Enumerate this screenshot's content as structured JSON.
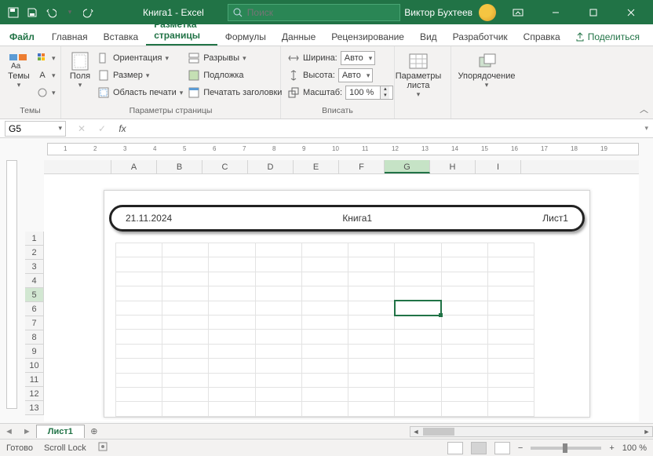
{
  "titlebar": {
    "title": "Книга1  -  Excel",
    "search_placeholder": "Поиск",
    "user": "Виктор Бухтеев"
  },
  "menu": {
    "file": "Файл",
    "tabs": [
      "Главная",
      "Вставка",
      "Разметка страницы",
      "Формулы",
      "Данные",
      "Рецензирование",
      "Вид",
      "Разработчик",
      "Справка"
    ],
    "active_index": 2,
    "share": "Поделиться"
  },
  "ribbon": {
    "themes": {
      "label": "Темы",
      "btn": "Темы"
    },
    "page_setup": {
      "label": "Параметры страницы",
      "fields_btn": "Поля",
      "orientation": "Ориентация",
      "size": "Размер",
      "print_area": "Область печати",
      "breaks": "Разрывы",
      "background": "Подложка",
      "print_titles": "Печатать заголовки"
    },
    "scale": {
      "label": "Вписать",
      "width": "Ширина:",
      "height": "Высота:",
      "scale_lbl": "Масштаб:",
      "auto": "Авто",
      "scale_val": "100 %"
    },
    "sheet_opts": {
      "label": "",
      "btn": "Параметры листа"
    },
    "arrange": {
      "label": "",
      "btn": "Упорядочение"
    }
  },
  "formula_bar": {
    "cell_ref": "G5",
    "fx": "fx",
    "formula": ""
  },
  "grid": {
    "columns": [
      "A",
      "B",
      "C",
      "D",
      "E",
      "F",
      "G",
      "H",
      "I"
    ],
    "selected_col": "G",
    "rows": [
      "1",
      "2",
      "3",
      "4",
      "5",
      "6",
      "7",
      "8",
      "9",
      "10",
      "11",
      "12",
      "13"
    ],
    "selected_row": "5",
    "header_left": "21.11.2024",
    "header_center": "Книга1",
    "header_right": "Лист1"
  },
  "ruler_numbers": [
    "1",
    "2",
    "3",
    "4",
    "5",
    "6",
    "7",
    "8",
    "9",
    "10",
    "11",
    "12",
    "13",
    "14",
    "15",
    "16",
    "17",
    "18",
    "19"
  ],
  "sheet_tabs": {
    "active": "Лист1"
  },
  "statusbar": {
    "ready": "Готово",
    "scroll_lock": "Scroll Lock",
    "zoom": "100 %"
  }
}
